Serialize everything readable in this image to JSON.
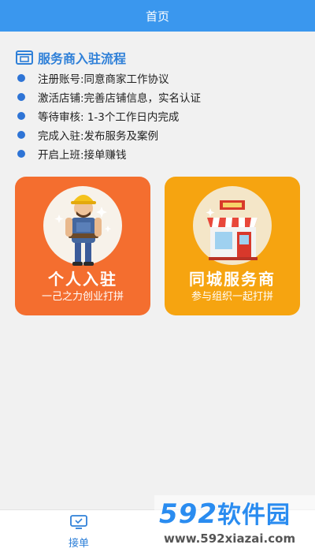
{
  "header": {
    "title": "首页"
  },
  "section": {
    "title": "服务商入驻流程",
    "icon": "shop-window-icon"
  },
  "steps": [
    "注册账号:同意商家工作协议",
    "激活店铺:完善店铺信息，实名认证",
    "等待审核: 1-3个工作日内完成",
    "完成入驻:发布服务及案例",
    "开启上班:接单赚钱"
  ],
  "cards": {
    "personal": {
      "title": "个人入驻",
      "subtitle": "一己之力创业打拼",
      "color": "#f46e2f",
      "icon": "worker-icon"
    },
    "local": {
      "title": "同城服务商",
      "subtitle": "参与组织一起打拼",
      "color": "#f6a410",
      "icon": "storefront-icon"
    }
  },
  "tabbar": {
    "active": {
      "label": "接单",
      "icon": "monitor-icon"
    }
  },
  "watermark": {
    "brand_num": "592",
    "brand_cn": "软件园",
    "url": "www.592xiazai.com"
  },
  "colors": {
    "primary": "#3a97ee",
    "accent_blue": "#2f80d8",
    "orange": "#f46e2f",
    "yellow": "#f6a410"
  }
}
